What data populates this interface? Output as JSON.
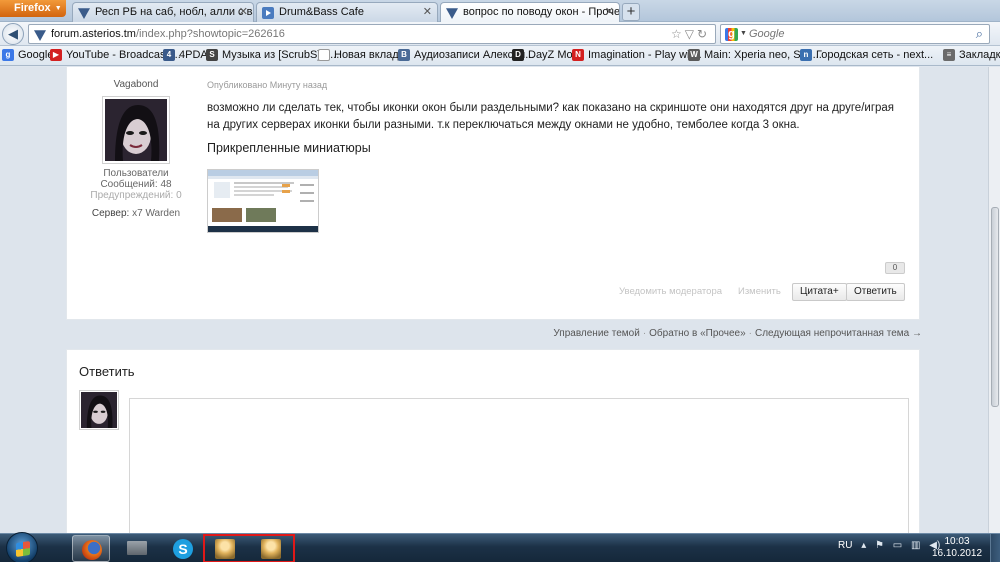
{
  "browser": {
    "app_button": "Firefox",
    "tabs": [
      {
        "title": "Респ РБ на саб, нобл, алли с варко..."
      },
      {
        "title": "Drum&Bass Cafe"
      },
      {
        "title": "вопрос по поводу окон - Прочее - ..."
      }
    ],
    "new_tab": "+",
    "url_domain": "forum.asterios.tm",
    "url_path": "/index.php?showtopic=262616",
    "search_placeholder": "Google",
    "bookmarks": [
      {
        "label": "Google",
        "icon": "google-icon",
        "color": "#3b78e7"
      },
      {
        "label": "YouTube - Broadcast ...",
        "icon": "youtube-icon",
        "color": "#d32020"
      },
      {
        "label": "4PDA",
        "icon": "4pda-icon",
        "color": "#3a5a8a"
      },
      {
        "label": "Музыка из [ScrubS] - ...",
        "icon": "music-icon",
        "color": "#444444"
      },
      {
        "label": "Новая вкладка",
        "icon": "page-icon",
        "color": "#888888"
      },
      {
        "label": "Аудиозаписи Алексея...",
        "icon": "vk-icon",
        "color": "#4a6a96"
      },
      {
        "label": "DayZ Mod",
        "icon": "dayz-icon",
        "color": "#222222"
      },
      {
        "label": "Imagination - Play wit...",
        "icon": "n-icon",
        "color": "#d32020"
      },
      {
        "label": "Main: Xperia neo, SI п...",
        "icon": "wiki-icon",
        "color": "#5a5a5a"
      },
      {
        "label": "Городская сеть - next...",
        "icon": "next-icon",
        "color": "#3a6fb0"
      },
      {
        "label": "Закладки",
        "icon": "bookmarks-icon",
        "color": "#6a6a6a"
      }
    ]
  },
  "post": {
    "author_name": "Vagabond",
    "author_group": "Пользователи",
    "author_posts": "Сообщений: 48",
    "author_warnings": "Предупреждений: 0",
    "server_label": "Сервер:",
    "server_value": "x7 Warden",
    "date": "Опубликовано Минуту назад",
    "body": "возможно ли сделать тек, чтобы иконки окон были раздельными? как показано на скриншоте они находятся друг на друге/играя на других серверах иконки были разными.  т.к переключаться между окнами не удобно, темболее когда  3 окна.",
    "attachments_title": "Прикрепленные миниатюры",
    "reputation": "0",
    "notify_moderator": "Уведомить модератора",
    "edit": "Изменить",
    "quote_button": "Цитата+",
    "reply_button": "Ответить"
  },
  "topic_nav": {
    "manage": "Управление темой",
    "back": "Обратно в «Прочее»",
    "next": "Следующая непрочитанная тема →"
  },
  "reply": {
    "title": "Ответить"
  },
  "taskbar": {
    "language": "RU",
    "time": "10:03",
    "date": "16.10.2012"
  }
}
